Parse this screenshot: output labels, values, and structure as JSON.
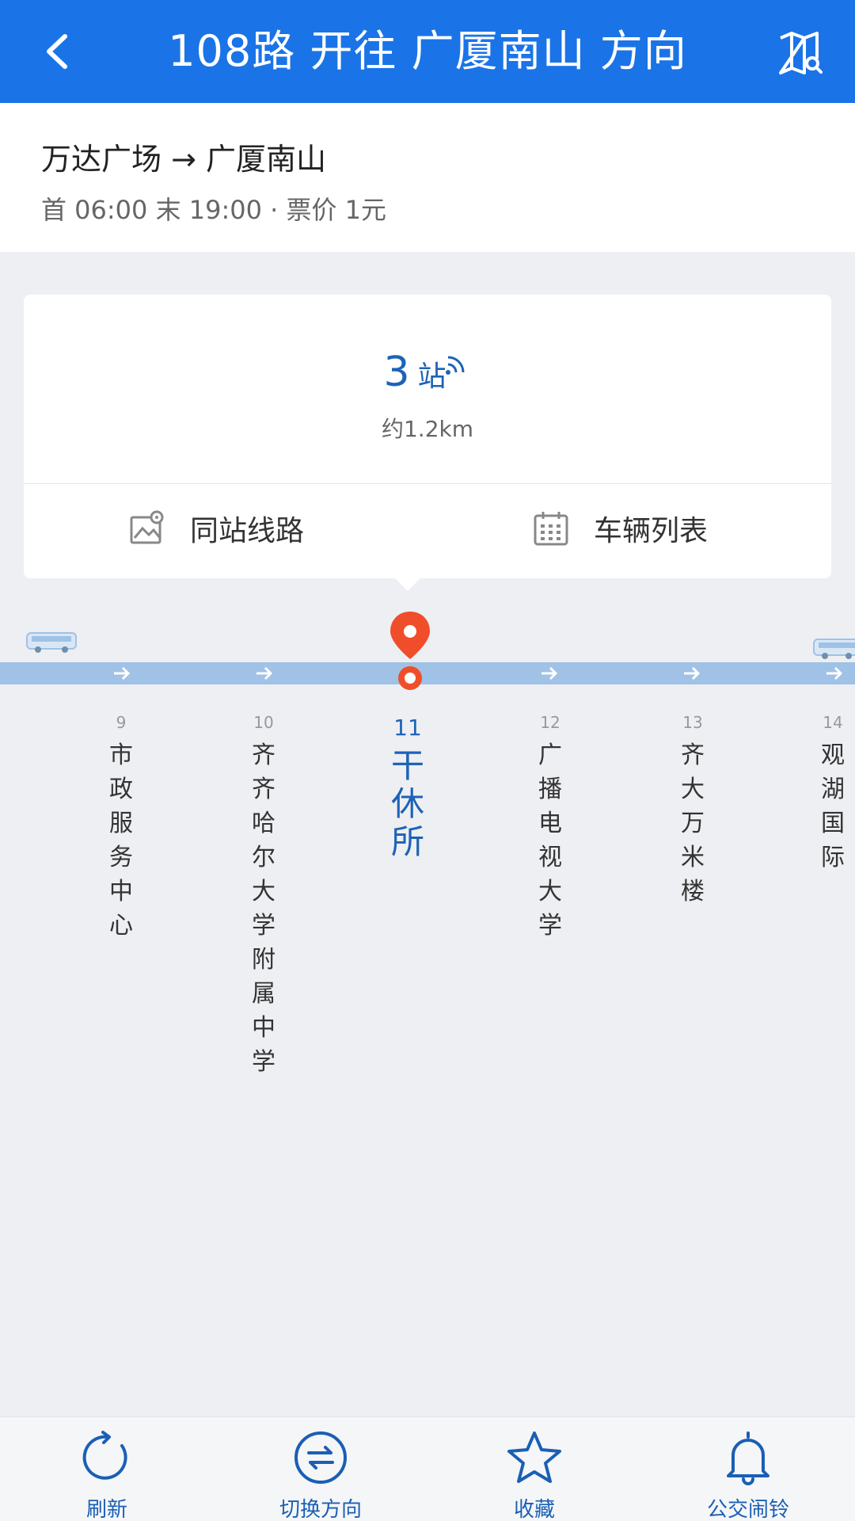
{
  "header": {
    "title": "108路 开往 广厦南山 方向",
    "background_color": "#1a74e8"
  },
  "route": {
    "name": "万达广场 → 广厦南山",
    "meta": "首 06:00 末 19:00 · 票价 1元"
  },
  "arrival": {
    "stops_number": "3",
    "stops_unit": "站",
    "distance": "约1.2km"
  },
  "actions": {
    "same_station_routes": "同站线路",
    "vehicle_list": "车辆列表"
  },
  "stops": [
    {
      "num": "9",
      "name": "市政服务中心"
    },
    {
      "num": "10",
      "name": "齐齐哈尔大学附属中学"
    },
    {
      "num": "11",
      "name": "干休所",
      "current": true
    },
    {
      "num": "12",
      "name": "广播电视大学"
    },
    {
      "num": "13",
      "name": "齐大万米楼"
    },
    {
      "num": "14",
      "name": "观湖国际"
    }
  ],
  "bottom_nav": [
    {
      "label": "刷新",
      "icon": "refresh-icon"
    },
    {
      "label": "切换方向",
      "icon": "switch-direction-icon"
    },
    {
      "label": "收藏",
      "icon": "star-icon"
    },
    {
      "label": "公交闹铃",
      "icon": "bell-icon"
    }
  ],
  "colors": {
    "accent": "#1d63b6",
    "route_line": "#9fc2e6",
    "pin": "#f04e2a"
  }
}
